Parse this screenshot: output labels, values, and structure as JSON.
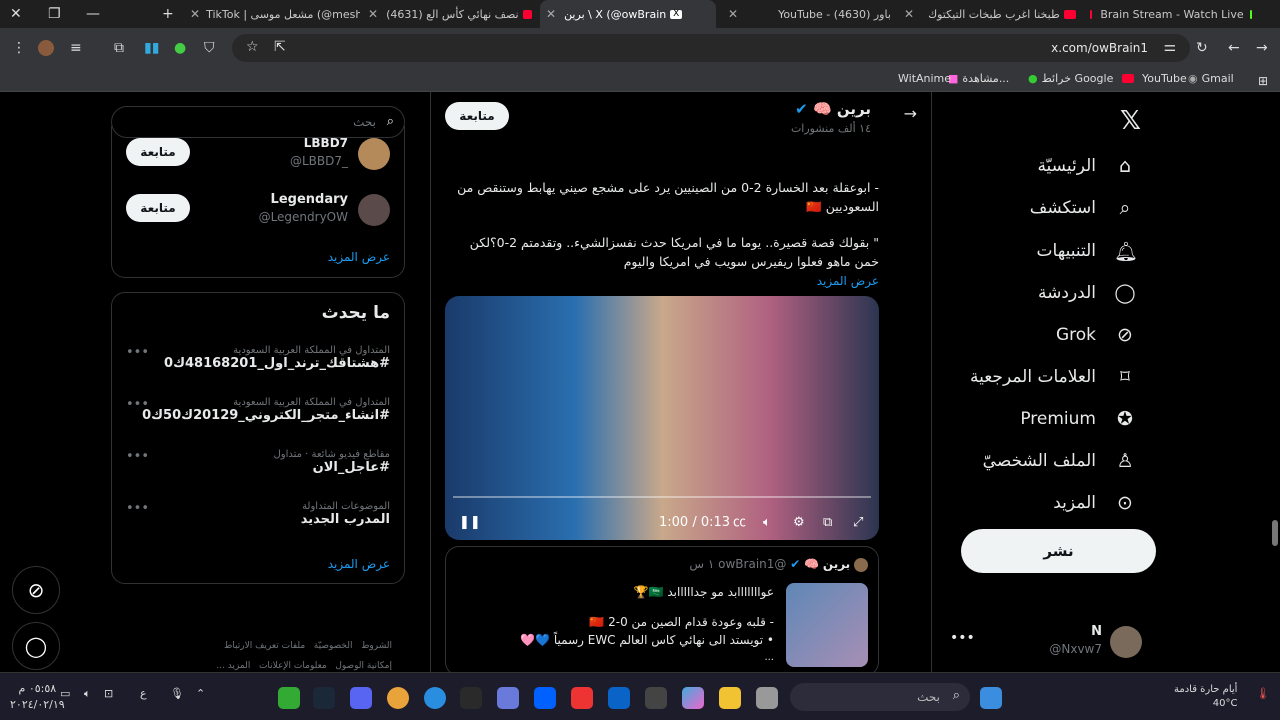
{
  "browser": {
    "tabs": [
      {
        "title": "TikTok | مشعل موسى (@meshal",
        "icon": "tiktok-icon"
      },
      {
        "title": "(4631) نصف نهائي كأس الع",
        "icon": "youtube-icon"
      },
      {
        "title": "برين \\ X (@owBrain",
        "icon": "x-icon",
        "active": true
      },
      {
        "title": "YouTube - باور (4630)",
        "icon": "youtube-icon"
      },
      {
        "title": "طبخنا اغرب طبخات التيكتوك",
        "icon": "youtube-icon"
      },
      {
        "title": "Brain Stream - Watch Live",
        "icon": "kick-icon"
      }
    ],
    "url": "x.com/owBrain1",
    "bookmarks": [
      "Gmail",
      "YouTube",
      "خرائط Google",
      "مشاهدة...",
      "WitAnime"
    ]
  },
  "nav": {
    "items": [
      "الرئيسيّة",
      "استكشف",
      "التنبيهات",
      "الدردشة",
      "Grok",
      "العلامات المرجعية",
      "Premium",
      "الملف الشخصيّ",
      "المزيد"
    ],
    "post_label": "نشر",
    "account_name": "N",
    "account_handle": "@Nxvw7"
  },
  "profile_header": {
    "name": "برين",
    "posts": "١٤ ألف منشورات",
    "follow_label": "متابعة"
  },
  "tweet": {
    "lines": [
      "- ابوعقلة بعد الخسارة 2-0 من الصينيين يرد على مشجع صيني يهابط وستنقص من السعوديين 🇨🇳",
      "\" بقولك قصة قصيرة.. يوما ما في امريكا حدث نفسزالشيء.. وتقدمتم 2-0؟لكن خمن ماهو فعلوا ريفيرس سويب في امريكا واليوم"
    ],
    "show_more": "عرض المزيد",
    "video_time": "1:00 / 0:13"
  },
  "tweet2": {
    "name": "برين",
    "handle": "@owBrain1",
    "time": "١ س",
    "line1": "عوااااااابد مو جدااااابد 🇸🇦🏆",
    "line2": "- قلبه وعودة قدام الصين من 0-2 🇨🇳",
    "line3": "• تويستد الى نهائي كاس العالم EWC رسمياً 💙🩷",
    "ellipsis": "..."
  },
  "sidebar": {
    "search_placeholder": "بحث",
    "who_to_follow": [
      {
        "name": "LBBD7",
        "handle": "@LBBD7_",
        "button": "متابعة"
      },
      {
        "name": "Legendary",
        "handle": "@LegendryOW",
        "button": "متابعة"
      }
    ],
    "show_more": "عرض المزيد",
    "trends_title": "ما يحدث",
    "trends": [
      {
        "meta": "المتداول في المملكة العربية السعودية",
        "name": "#هشتاقك_ترند_اول_48168201ك0"
      },
      {
        "meta": "المتداول في المملكة العربية السعودية",
        "name": "#انشاء_متجر_الكتروني_20129ك50ك0"
      },
      {
        "meta": "مقاطع فيديو شائعة · متداول",
        "name": "#عاجل_الان"
      },
      {
        "meta": "الموضوعات المتداولة",
        "name": "المدرب الجديد"
      }
    ],
    "trends_show_more": "عرض المزيد",
    "footer": [
      "الشروط",
      "الخصوصيّة",
      "ملفات تعريف الارتباط",
      "إمكانية الوصول",
      "معلومات الإعلانات",
      "المزيد ..."
    ]
  },
  "taskbar": {
    "search_placeholder": "بحث",
    "weather_text": "أيام حارة قادمة",
    "weather_temp": "40°C",
    "time": "٠٥:٥٨ م",
    "date": "٢٠٢٤/٠٢/١٩",
    "lang": "ع"
  }
}
